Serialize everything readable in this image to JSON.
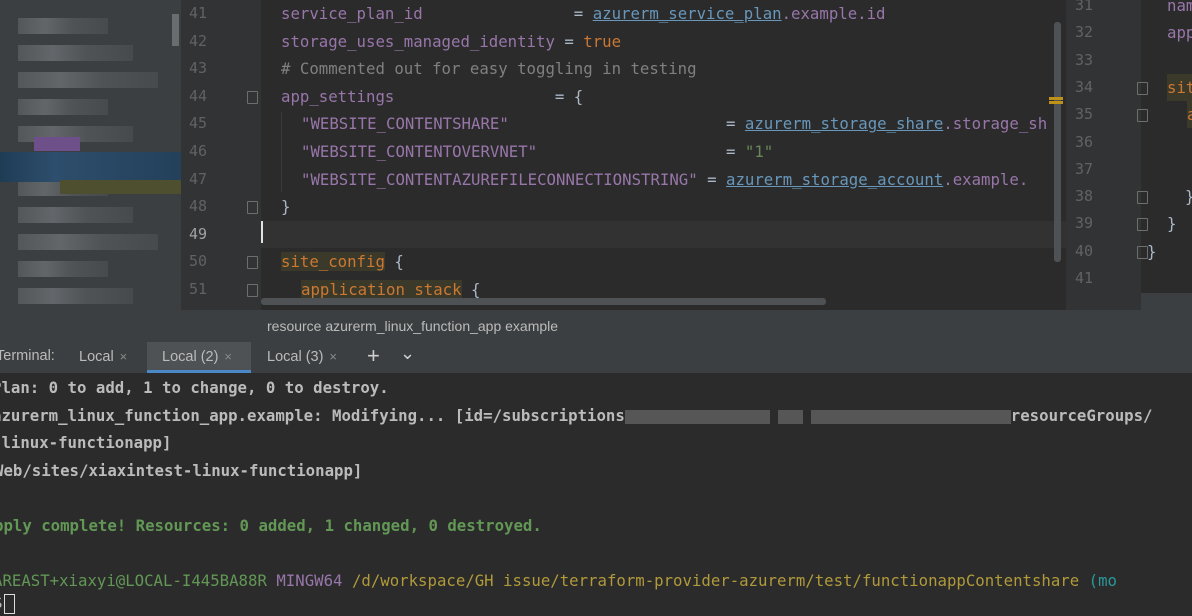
{
  "editor": {
    "lines": [
      {
        "num": "41",
        "indent": 0,
        "parts": [
          {
            "t": "service_plan_id",
            "c": "k"
          },
          {
            "t": "                = ",
            "c": "o"
          },
          {
            "t": "azurerm_service_plan",
            "c": "ref"
          },
          {
            "t": ".example.id",
            "c": "k"
          }
        ]
      },
      {
        "num": "42",
        "indent": 0,
        "parts": [
          {
            "t": "storage_uses_managed_identity",
            "c": "k"
          },
          {
            "t": " = ",
            "c": "o"
          },
          {
            "t": "true",
            "c": "bool"
          }
        ]
      },
      {
        "num": "43",
        "indent": 0,
        "parts": [
          {
            "t": "# Commented out for easy toggling in testing",
            "c": "cm"
          }
        ]
      },
      {
        "num": "44",
        "indent": 0,
        "parts": [
          {
            "t": "app_settings",
            "c": "k"
          },
          {
            "t": "                 = {",
            "c": "o"
          }
        ]
      },
      {
        "num": "45",
        "indent": 1,
        "parts": [
          {
            "t": "\"WEBSITE_CONTENTSHARE\"",
            "c": "k"
          },
          {
            "t": "                       = ",
            "c": "o"
          },
          {
            "t": "azurerm_storage_share",
            "c": "ref"
          },
          {
            "t": ".storage_sh",
            "c": "k"
          }
        ]
      },
      {
        "num": "46",
        "indent": 1,
        "parts": [
          {
            "t": "\"WEBSITE_CONTENTOVERVNET\"",
            "c": "k"
          },
          {
            "t": "                    = ",
            "c": "o"
          },
          {
            "t": "\"1\"",
            "c": "str"
          }
        ]
      },
      {
        "num": "47",
        "indent": 1,
        "parts": [
          {
            "t": "\"WEBSITE_CONTENTAZUREFILECONNECTIONSTRING\"",
            "c": "k"
          },
          {
            "t": " = ",
            "c": "o"
          },
          {
            "t": "azurerm_storage_account",
            "c": "ref"
          },
          {
            "t": ".example.",
            "c": "k"
          }
        ]
      },
      {
        "num": "48",
        "indent": 0,
        "parts": [
          {
            "t": "}",
            "c": "o"
          }
        ]
      },
      {
        "num": "49",
        "indent": 0,
        "parts": []
      },
      {
        "num": "50",
        "indent": 0,
        "parts": [
          {
            "t": "site_config",
            "c": "blk"
          },
          {
            "t": " {",
            "c": "o"
          }
        ]
      },
      {
        "num": "51",
        "indent": 1,
        "parts": [
          {
            "t": "application_stack",
            "c": "blk"
          },
          {
            "t": " {",
            "c": "o"
          }
        ]
      }
    ],
    "right_lines": [
      {
        "num": "31",
        "text": "nam"
      },
      {
        "num": "32",
        "text": "app"
      },
      {
        "num": "33",
        "text": ""
      },
      {
        "num": "34",
        "text": "sit"
      },
      {
        "num": "35",
        "text": "a"
      },
      {
        "num": "36",
        "text": ""
      },
      {
        "num": "37",
        "text": ""
      },
      {
        "num": "38",
        "text": "}"
      },
      {
        "num": "39",
        "text": "}"
      },
      {
        "num": "40",
        "text": "}"
      },
      {
        "num": "41",
        "text": ""
      }
    ]
  },
  "breadcrumb": "resource azurerm_linux_function_app example",
  "terminal": {
    "label": "Terminal:",
    "tabs": [
      {
        "label": "Local",
        "close": "×"
      },
      {
        "label": "Local (2)",
        "close": "×"
      },
      {
        "label": "Local (3)",
        "close": "×"
      }
    ],
    "add_icon": "+",
    "dropdown_icon": "⌄",
    "lines": {
      "plan": "Plan: 0 to add, 1 to change, 0 to destroy.",
      "modifying_a": "azurerm_linux_function_app.example: Modifying... [id=/subscriptions",
      "modifying_b": "resourceGroups/",
      "l3": "-linux-functionapp]",
      "l4": "Web/sites/xiaxintest-linux-functionapp]",
      "apply": "pply complete! Resources: 0 added, 1 changed, 0 destroyed.",
      "prompt_user": "AREAST+xiaxyi@LOCAL-I445BA88R",
      "prompt_shell": "MINGW64",
      "prompt_path": "/d/workspace/GH issue/terraform-provider-azurerm/test/functionappContentshare",
      "prompt_branch": "(mo",
      "cursor_line": "$"
    }
  }
}
